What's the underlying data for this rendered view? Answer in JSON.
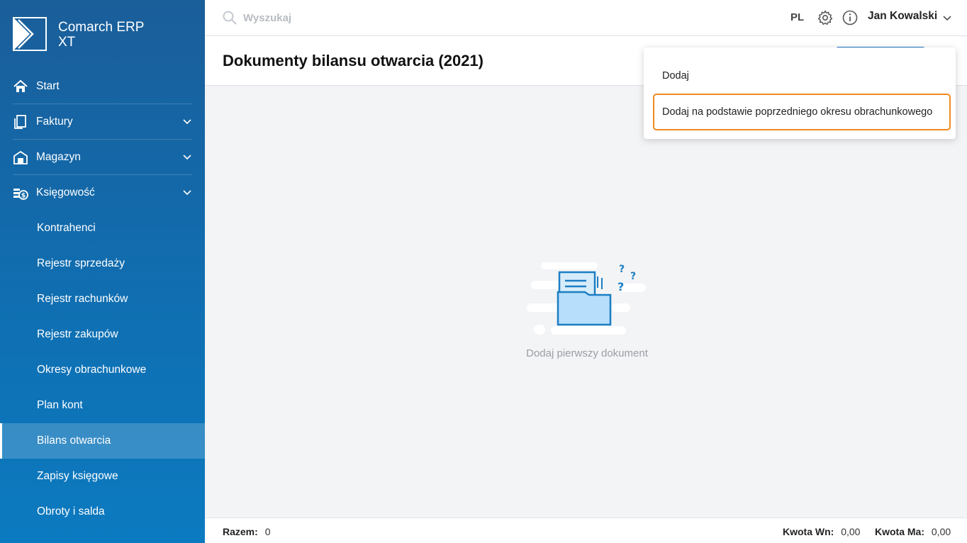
{
  "app": {
    "name_line1": "Comarch ERP",
    "name_line2": "XT"
  },
  "sidebar": {
    "items": [
      {
        "label": "Start",
        "icon": "home-icon"
      },
      {
        "label": "Faktury",
        "icon": "invoice-icon"
      },
      {
        "label": "Magazyn",
        "icon": "warehouse-icon"
      },
      {
        "label": "Księgowość",
        "icon": "accounting-icon"
      }
    ],
    "subitems": [
      {
        "label": "Kontrahenci"
      },
      {
        "label": "Rejestr sprzedaży"
      },
      {
        "label": "Rejestr rachunków"
      },
      {
        "label": "Rejestr zakupów"
      },
      {
        "label": "Okresy obrachunkowe"
      },
      {
        "label": "Plan kont"
      },
      {
        "label": "Bilans otwarcia",
        "active": true
      },
      {
        "label": "Zapisy księgowe"
      },
      {
        "label": "Obroty i salda"
      }
    ]
  },
  "topbar": {
    "search_placeholder": "Wyszukaj",
    "lang": "PL",
    "user": "Jan Kowalski"
  },
  "header": {
    "title": "Dokumenty bilansu otwarcia (2021)"
  },
  "menu": {
    "items": [
      "Dodaj",
      "Dodaj na podstawie poprzedniego okresu obrachunkowego"
    ]
  },
  "empty_state": {
    "text": "Dodaj pierwszy dokument"
  },
  "footer": {
    "total_label": "Razem:",
    "total_value": "0",
    "wn_label": "Kwota Wn:",
    "wn_value": "0,00",
    "ma_label": "Kwota Ma:",
    "ma_value": "0,00"
  },
  "colors": {
    "sidebar": "#1a5e9a",
    "accent": "#1a73c2",
    "highlight": "#f08a1c"
  }
}
